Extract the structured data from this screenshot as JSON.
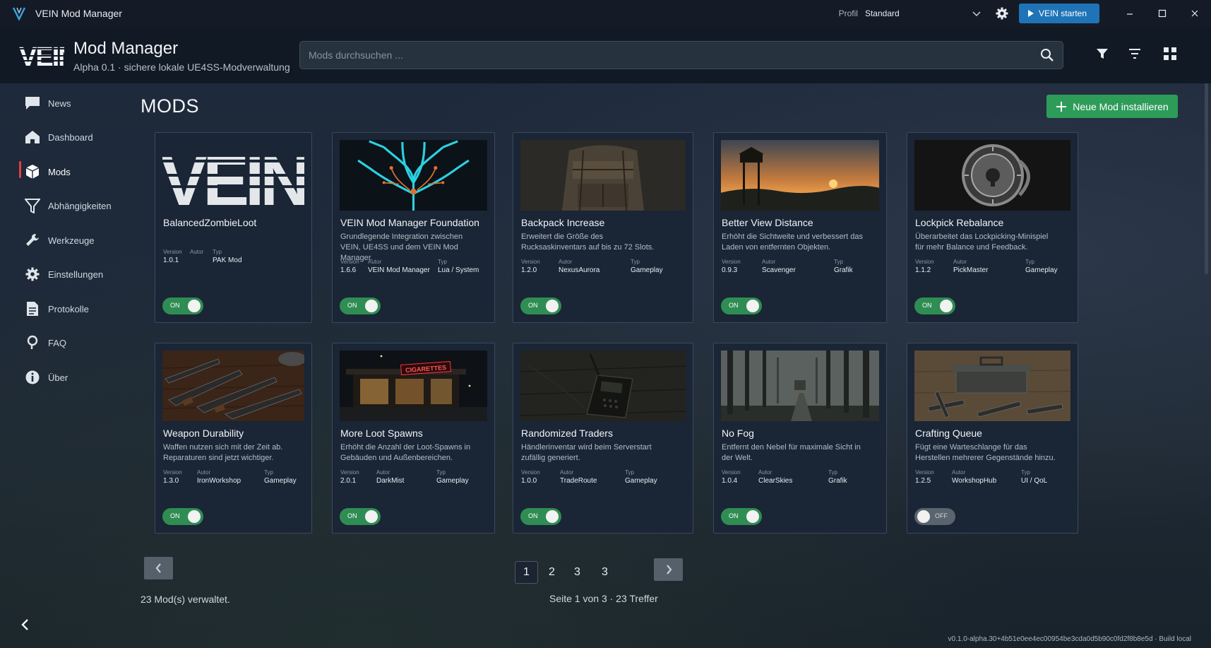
{
  "window": {
    "title": "VEIN Mod Manager",
    "profile_label": "Profil",
    "profile_value": "Standard",
    "start_label": "VEIN starten"
  },
  "header": {
    "logo_text": "VEIN",
    "title": "Mod Manager",
    "subtitle": "Alpha 0.1 · sichere lokale UE4SS-Modverwaltung",
    "search_placeholder": "Mods durchsuchen ..."
  },
  "sidebar": {
    "items": [
      {
        "label": "News",
        "icon": "news-icon"
      },
      {
        "label": "Dashboard",
        "icon": "home-icon"
      },
      {
        "label": "Mods",
        "icon": "box-icon",
        "active": true
      },
      {
        "label": "Abhängigkeiten",
        "icon": "funnel-icon"
      },
      {
        "label": "Werkzeuge",
        "icon": "wrench-icon"
      },
      {
        "label": "Einstellungen",
        "icon": "gear-icon"
      },
      {
        "label": "Protokolle",
        "icon": "document-icon"
      },
      {
        "label": "FAQ",
        "icon": "question-icon"
      },
      {
        "label": "Über",
        "icon": "info-icon"
      }
    ]
  },
  "main": {
    "title": "MODS",
    "new_mod_label": "Neue Mod installieren",
    "meta_labels": {
      "version": "Version",
      "author": "Autor",
      "type": "Typ"
    },
    "mods": [
      {
        "name": "BalancedZombieLoot",
        "description": "",
        "version": "1.0.1",
        "author": "",
        "type": "PAK Mod",
        "enabled": true,
        "image": "vein-logo"
      },
      {
        "name": "VEIN Mod Manager Foundation",
        "description": "Grundlegende Integration zwischen VEIN, UE4SS und dem VEIN Mod Manager.",
        "version": "1.6.6",
        "author": "VEIN Mod Manager",
        "type": "Lua / System",
        "enabled": true,
        "image": "circuit-tree"
      },
      {
        "name": "Backpack Increase",
        "description": "Erweitert die Größe des Rucksaskinventars auf bis zu 72 Slots.",
        "version": "1.2.0",
        "author": "NexusAurora",
        "type": "Gameplay",
        "enabled": true,
        "image": "backpack"
      },
      {
        "name": "Better View Distance",
        "description": "Erhöht die Sichtweite und verbessert das Laden von entfernten Objekten.",
        "version": "0.9.3",
        "author": "Scavenger",
        "type": "Grafik",
        "enabled": true,
        "image": "watchtower"
      },
      {
        "name": "Lockpick Rebalance",
        "description": "Überarbeitet das Lockpicking-Minispiel für mehr Balance und Feedback.",
        "version": "1.1.2",
        "author": "PickMaster",
        "type": "Gameplay",
        "enabled": true,
        "image": "lock-dial"
      },
      {
        "name": "Weapon Durability",
        "description": "Waffen nutzen sich mit der Zeit ab. Reparaturen sind jetzt wichtiger.",
        "version": "1.3.0",
        "author": "IronWorkshop",
        "type": "Gameplay",
        "enabled": true,
        "image": "rifles"
      },
      {
        "name": "More Loot Spawns",
        "description": "Erhöht die Anzahl der Loot-Spawns in Gebäuden und Außenbereichen.",
        "version": "2.0.1",
        "author": "DarkMist",
        "type": "Gameplay",
        "enabled": true,
        "image": "cigarettes-store",
        "sign_text": "CIGARETTES"
      },
      {
        "name": "Randomized Traders",
        "description": "Händlerinventar wird beim Serverstart zufällig generiert.",
        "version": "1.0.0",
        "author": "TradeRoute",
        "type": "Gameplay",
        "enabled": true,
        "image": "radio"
      },
      {
        "name": "No Fog",
        "description": "Entfernt den Nebel für maximale Sicht in der Welt.",
        "version": "1.0.4",
        "author": "ClearSkies",
        "type": "Grafik",
        "enabled": true,
        "image": "foggy-forest"
      },
      {
        "name": "Crafting Queue",
        "description": "Fügt eine Warteschlange für das Herstellen mehrerer Gegenstände hinzu.",
        "version": "1.2.5",
        "author": "WorkshopHub",
        "type": "UI / QoL",
        "enabled": false,
        "image": "toolbox"
      }
    ],
    "toggle_on": "ON",
    "toggle_off": "OFF"
  },
  "pagination": {
    "pages": [
      "1",
      "2",
      "3",
      "3"
    ],
    "current": "1",
    "page_info": "Seite 1 von 3 · 23 Treffer"
  },
  "footer": {
    "count": "23 Mod(s) verwaltet.",
    "build": "v0.1.0-alpha.30+4b51e0ee4ec00954be3cda0d5b90c0fd2f8b8e5d  ·  Build local"
  },
  "colors": {
    "accent_green": "#2e9c59",
    "accent_blue": "#1f74b8",
    "active_marker": "#e04040"
  }
}
